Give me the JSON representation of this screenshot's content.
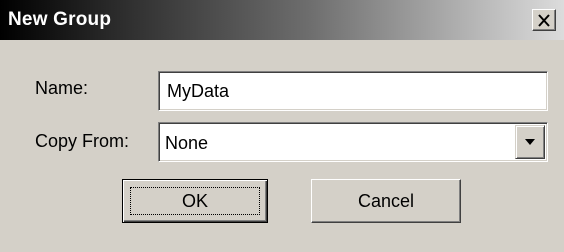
{
  "window": {
    "title": "New Group",
    "close_symbol": "×"
  },
  "form": {
    "name_label": "Name:",
    "name_value": "MyData",
    "copy_from_label": "Copy From:",
    "copy_from_value": "None"
  },
  "buttons": {
    "ok_label": "OK",
    "cancel_label": "Cancel"
  },
  "icons": {
    "close": "close-icon",
    "dropdown": "chevron-down-icon"
  },
  "colors": {
    "face": "#d4d0c8",
    "title_start": "#000000",
    "title_end": "#dcdcdc",
    "title_text": "#ffffff"
  }
}
